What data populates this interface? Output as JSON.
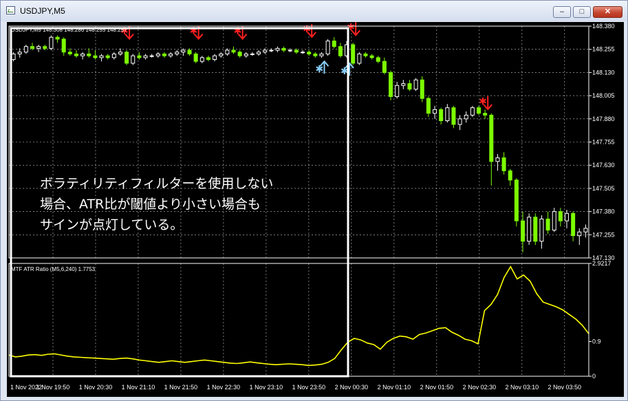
{
  "window": {
    "title": "USDJPY,M5",
    "buttons": {
      "minimize": "–",
      "maximize": "□",
      "close": "✕"
    }
  },
  "chart": {
    "symbol_label": "USDJPY,M5  148.308 148.286 148.255 148.257",
    "indicator_label": "MTF ATR Ratio  (M5,6,240) 1.7753",
    "annotation_lines": [
      "ボラティリティフィルターを使用しない",
      "場合、ATR比が閾値より小さい場合も",
      "サインが点灯している。"
    ],
    "colors": {
      "background": "#000000",
      "grid": "#c8c8c8",
      "up_candle": "#ffffff",
      "down_candle": "#7cfc00",
      "atr_line": "#ffff00",
      "sell_signal": "#ff2020",
      "buy_signal": "#87cefa",
      "highlight_box": "#ffffff"
    }
  },
  "chart_data": [
    {
      "type": "candlestick",
      "price_axis_ticks": [
        "148.380",
        "148.255",
        "148.130",
        "148.005",
        "147.880",
        "147.755",
        "147.630",
        "147.505",
        "147.380",
        "147.255",
        "147.130"
      ],
      "time_axis_ticks": [
        "1 Nov 2022",
        "1 Nov 19:50",
        "1 Nov 20:30",
        "1 Nov 21:10",
        "1 Nov 21:50",
        "1 Nov 22:30",
        "1 Nov 23:10",
        "1 Nov 23:50",
        "2 Nov 00:30",
        "2 Nov 01:10",
        "2 Nov 01:50",
        "2 Nov 02:30",
        "2 Nov 03:10",
        "2 Nov 03:50"
      ],
      "ylim": [
        147.13,
        148.38
      ],
      "candles": [
        [
          148.2,
          148.24,
          148.19,
          148.23
        ],
        [
          148.23,
          148.26,
          148.21,
          148.24
        ],
        [
          148.24,
          148.28,
          148.23,
          148.27
        ],
        [
          148.27,
          148.29,
          148.25,
          148.26
        ],
        [
          148.26,
          148.28,
          148.24,
          148.27
        ],
        [
          148.27,
          148.28,
          148.25,
          148.26
        ],
        [
          148.26,
          148.33,
          148.25,
          148.32
        ],
        [
          148.32,
          148.33,
          148.29,
          148.31
        ],
        [
          148.31,
          148.32,
          148.22,
          148.24
        ],
        [
          148.24,
          148.26,
          148.22,
          148.23
        ],
        [
          148.23,
          148.25,
          148.21,
          148.22
        ],
        [
          148.22,
          148.24,
          148.2,
          148.23
        ],
        [
          148.23,
          148.26,
          148.21,
          148.22
        ],
        [
          148.22,
          148.25,
          148.2,
          148.21
        ],
        [
          148.21,
          148.23,
          148.19,
          148.22
        ],
        [
          148.22,
          148.23,
          148.2,
          148.21
        ],
        [
          148.21,
          148.24,
          148.2,
          148.23
        ],
        [
          148.23,
          148.26,
          148.22,
          148.24
        ],
        [
          148.24,
          148.25,
          148.17,
          148.18
        ],
        [
          148.18,
          148.23,
          148.17,
          148.22
        ],
        [
          148.22,
          148.24,
          148.2,
          148.21
        ],
        [
          148.21,
          148.23,
          148.2,
          148.22
        ],
        [
          148.22,
          148.23,
          148.21,
          148.22
        ],
        [
          148.22,
          148.24,
          148.21,
          148.23
        ],
        [
          148.23,
          148.24,
          148.21,
          148.22
        ],
        [
          148.22,
          148.24,
          148.21,
          148.23
        ],
        [
          148.23,
          148.25,
          148.22,
          148.24
        ],
        [
          148.24,
          148.26,
          148.22,
          148.25
        ],
        [
          148.25,
          148.26,
          148.22,
          148.23
        ],
        [
          148.23,
          148.24,
          148.18,
          148.19
        ],
        [
          148.19,
          148.22,
          148.18,
          148.21
        ],
        [
          148.21,
          148.22,
          148.19,
          148.2
        ],
        [
          148.2,
          148.23,
          148.19,
          148.22
        ],
        [
          148.22,
          148.24,
          148.21,
          148.23
        ],
        [
          148.23,
          148.26,
          148.22,
          148.25
        ],
        [
          148.25,
          148.27,
          148.23,
          148.24
        ],
        [
          148.24,
          148.25,
          148.21,
          148.22
        ],
        [
          148.22,
          148.24,
          148.21,
          148.23
        ],
        [
          148.23,
          148.24,
          148.22,
          148.23
        ],
        [
          148.23,
          148.25,
          148.22,
          148.24
        ],
        [
          148.24,
          148.26,
          148.23,
          148.25
        ],
        [
          148.25,
          148.26,
          148.24,
          148.25
        ],
        [
          148.25,
          148.27,
          148.24,
          148.26
        ],
        [
          148.26,
          148.27,
          148.24,
          148.25
        ],
        [
          148.25,
          148.26,
          148.24,
          148.25
        ],
        [
          148.25,
          148.26,
          148.23,
          148.24
        ],
        [
          148.24,
          148.25,
          148.23,
          148.24
        ],
        [
          148.24,
          148.25,
          148.22,
          148.23
        ],
        [
          148.23,
          148.24,
          148.21,
          148.22
        ],
        [
          148.22,
          148.24,
          148.21,
          148.23
        ],
        [
          148.23,
          148.31,
          148.22,
          148.3
        ],
        [
          148.3,
          148.32,
          148.26,
          148.27
        ],
        [
          148.27,
          148.29,
          148.21,
          148.22
        ],
        [
          148.22,
          148.3,
          148.21,
          148.28
        ],
        [
          148.28,
          148.29,
          148.17,
          148.18
        ],
        [
          148.18,
          148.24,
          148.17,
          148.23
        ],
        [
          148.23,
          148.24,
          148.21,
          148.22
        ],
        [
          148.22,
          148.23,
          148.2,
          148.21
        ],
        [
          148.21,
          148.22,
          148.18,
          148.19
        ],
        [
          148.19,
          148.21,
          148.12,
          148.13
        ],
        [
          148.13,
          148.14,
          147.98,
          148.0
        ],
        [
          148.0,
          148.08,
          147.99,
          148.06
        ],
        [
          148.06,
          148.09,
          148.04,
          148.07
        ],
        [
          148.07,
          148.09,
          148.03,
          148.04
        ],
        [
          148.04,
          148.1,
          148.03,
          148.09
        ],
        [
          148.09,
          148.11,
          147.97,
          147.99
        ],
        [
          147.99,
          148.0,
          147.89,
          147.91
        ],
        [
          147.91,
          147.95,
          147.88,
          147.93
        ],
        [
          147.93,
          147.94,
          147.85,
          147.87
        ],
        [
          147.87,
          147.96,
          147.86,
          147.94
        ],
        [
          147.94,
          147.95,
          147.83,
          147.85
        ],
        [
          147.85,
          147.9,
          147.82,
          147.88
        ],
        [
          147.88,
          147.92,
          147.86,
          147.9
        ],
        [
          147.9,
          147.95,
          147.89,
          147.94
        ],
        [
          147.94,
          147.95,
          147.9,
          147.91
        ],
        [
          147.91,
          147.93,
          147.88,
          147.9
        ],
        [
          147.9,
          147.91,
          147.52,
          147.65
        ],
        [
          147.65,
          147.69,
          147.6,
          147.67
        ],
        [
          147.67,
          147.7,
          147.58,
          147.6
        ],
        [
          147.6,
          147.61,
          147.52,
          147.55
        ],
        [
          147.55,
          147.56,
          147.3,
          147.33
        ],
        [
          147.33,
          147.38,
          147.16,
          147.22
        ],
        [
          147.22,
          147.37,
          147.2,
          147.35
        ],
        [
          147.35,
          147.37,
          147.2,
          147.22
        ],
        [
          147.22,
          147.36,
          147.18,
          147.34
        ],
        [
          147.34,
          147.38,
          147.26,
          147.28
        ],
        [
          147.28,
          147.4,
          147.27,
          147.38
        ],
        [
          147.38,
          147.4,
          147.3,
          147.33
        ],
        [
          147.33,
          147.39,
          147.29,
          147.37
        ],
        [
          147.37,
          147.38,
          147.22,
          147.25
        ],
        [
          147.25,
          147.29,
          147.2,
          147.27
        ],
        [
          147.27,
          147.31,
          147.24,
          147.29
        ]
      ],
      "signals": [
        {
          "kind": "sell",
          "index": 18,
          "price": 148.3
        },
        {
          "kind": "sell",
          "index": 29,
          "price": 148.3
        },
        {
          "kind": "sell",
          "index": 36,
          "price": 148.3
        },
        {
          "kind": "sell",
          "index": 47,
          "price": 148.31
        },
        {
          "kind": "buy",
          "index": 49,
          "price": 148.19
        },
        {
          "kind": "buy",
          "index": 53,
          "price": 148.18
        },
        {
          "kind": "sell",
          "index": 54,
          "price": 148.32
        },
        {
          "kind": "sell",
          "index": 75,
          "price": 147.92
        }
      ]
    },
    {
      "type": "line",
      "title": "MTF ATR Ratio  (M5,6,240) 1.7753",
      "ticks": [
        "2.9217",
        "0.9",
        "0"
      ],
      "ylim": [
        0,
        2.9217
      ],
      "series": [
        {
          "name": "MTF ATR Ratio",
          "values": [
            0.55,
            0.5,
            0.52,
            0.55,
            0.56,
            0.54,
            0.57,
            0.58,
            0.55,
            0.52,
            0.5,
            0.49,
            0.48,
            0.47,
            0.46,
            0.45,
            0.44,
            0.46,
            0.47,
            0.45,
            0.42,
            0.4,
            0.38,
            0.36,
            0.38,
            0.4,
            0.38,
            0.36,
            0.38,
            0.4,
            0.42,
            0.4,
            0.38,
            0.36,
            0.34,
            0.33,
            0.35,
            0.37,
            0.35,
            0.33,
            0.31,
            0.3,
            0.31,
            0.32,
            0.31,
            0.3,
            0.28,
            0.29,
            0.31,
            0.36,
            0.46,
            0.68,
            0.88,
            0.98,
            0.94,
            0.86,
            0.82,
            0.7,
            0.88,
            0.98,
            1.04,
            1.02,
            0.96,
            1.08,
            1.12,
            1.18,
            1.24,
            1.26,
            1.14,
            1.06,
            0.96,
            0.92,
            0.84,
            1.7,
            1.86,
            2.12,
            2.56,
            2.84,
            2.52,
            2.62,
            2.46,
            2.14,
            1.92,
            1.86,
            1.8,
            1.72,
            1.6,
            1.48,
            1.32,
            1.1
          ]
        }
      ]
    }
  ]
}
